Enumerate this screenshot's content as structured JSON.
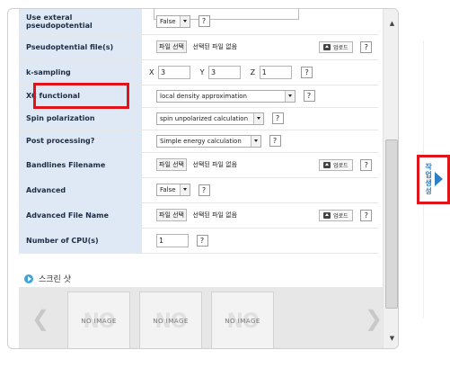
{
  "form": {
    "rows": [
      {
        "label": "Use exteral pseudopotential",
        "type": "select",
        "value": "False",
        "help": "?"
      },
      {
        "label": "Pseudoptential file(s)",
        "type": "file",
        "file_button": "파일 선택",
        "file_text": "선택된 파일 없음",
        "upload_label": "업로드",
        "help": "?"
      },
      {
        "label": "k-sampling",
        "type": "xyz",
        "x_label": "X",
        "x_value": "3",
        "y_label": "Y",
        "y_value": "3",
        "z_label": "Z",
        "z_value": "1",
        "help": "?"
      },
      {
        "label": "XC functional",
        "type": "select",
        "value": "local density approximation",
        "help": "?"
      },
      {
        "label": "Spin polarization",
        "type": "select",
        "value": "spin unpolarized calculation",
        "help": "?"
      },
      {
        "label": "Post processing?",
        "type": "select",
        "value": "Simple energy calculation",
        "help": "?"
      },
      {
        "label": "Bandlines Filename",
        "type": "file",
        "file_button": "파일 선택",
        "file_text": "선택된 파일 없음",
        "upload_label": "업로드",
        "help": "?"
      },
      {
        "label": "Advanced",
        "type": "select",
        "value": "False",
        "help": "?"
      },
      {
        "label": "Advanced File Name",
        "type": "file",
        "file_button": "파일 선택",
        "file_text": "선택된 파일 없음",
        "upload_label": "업로드",
        "help": "?"
      },
      {
        "label": "Number of CPU(s)",
        "type": "input",
        "value": "1",
        "help": "?"
      }
    ]
  },
  "screenshot": {
    "title": "스크린 샷",
    "prev": "❮",
    "next": "❯",
    "thumbs": [
      {
        "watermark": "NO",
        "label": "NO IMAGE"
      },
      {
        "watermark": "NO",
        "label": "NO IMAGE"
      },
      {
        "watermark": "NO",
        "label": "NO IMAGE"
      }
    ]
  },
  "scrollbar": {
    "up": "▲",
    "down": "▼"
  },
  "side_tab": {
    "label": "작업생성"
  },
  "colors": {
    "highlight": "#e0141b",
    "label_bg": "#dfe9f5",
    "accent": "#2d7fc8"
  }
}
